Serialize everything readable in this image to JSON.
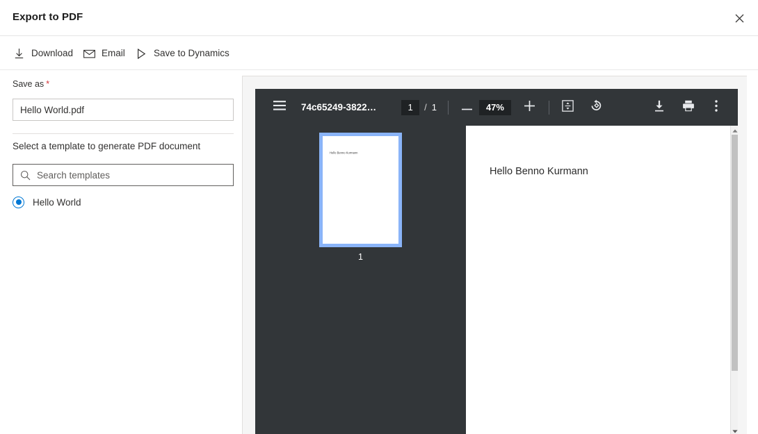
{
  "dialog": {
    "title": "Export to PDF",
    "close_icon": "close-icon"
  },
  "commandbar": {
    "items": [
      {
        "label": "Download",
        "icon": "download-icon"
      },
      {
        "label": "Email",
        "icon": "envelope-icon"
      },
      {
        "label": "Save to Dynamics",
        "icon": "play-triangle-icon"
      }
    ]
  },
  "sidebar": {
    "save_as_label": "Save as",
    "required_marker": "*",
    "filename_value": "Hello World.pdf",
    "filename_placeholder": "File name",
    "template_section_label": "Select a template to generate PDF document",
    "search_placeholder": "Search templates",
    "search_value": "",
    "search_icon": "search-icon",
    "templates": [
      {
        "label": "Hello World",
        "selected": true
      }
    ]
  },
  "pdf_viewer": {
    "menu_icon": "hamburger-menu-icon",
    "filename": "74c65249-3822…",
    "current_page": "1",
    "page_separator": "/",
    "total_pages": "1",
    "zoom_out_icon": "minus-icon",
    "zoom_level": "47%",
    "zoom_in_icon": "plus-icon",
    "fit_page_icon": "fit-to-page-icon",
    "rotate_icon": "rotate-counterclockwise-icon",
    "download_icon": "download-icon",
    "print_icon": "print-icon",
    "more_icon": "more-vertical-icon",
    "thumbnail": {
      "page_text": "Hello Benno Kurmann",
      "page_number": "1"
    },
    "document": {
      "body_text": "Hello Benno Kurmann"
    },
    "scrollbar": {
      "up_arrow_icon": "caret-up-icon",
      "down_arrow_icon": "caret-down-icon"
    }
  },
  "colors": {
    "accent": "#0078d4",
    "required": "#d13438",
    "toolbar_dark": "#323639",
    "thumb_selection": "#8ab4f8"
  }
}
